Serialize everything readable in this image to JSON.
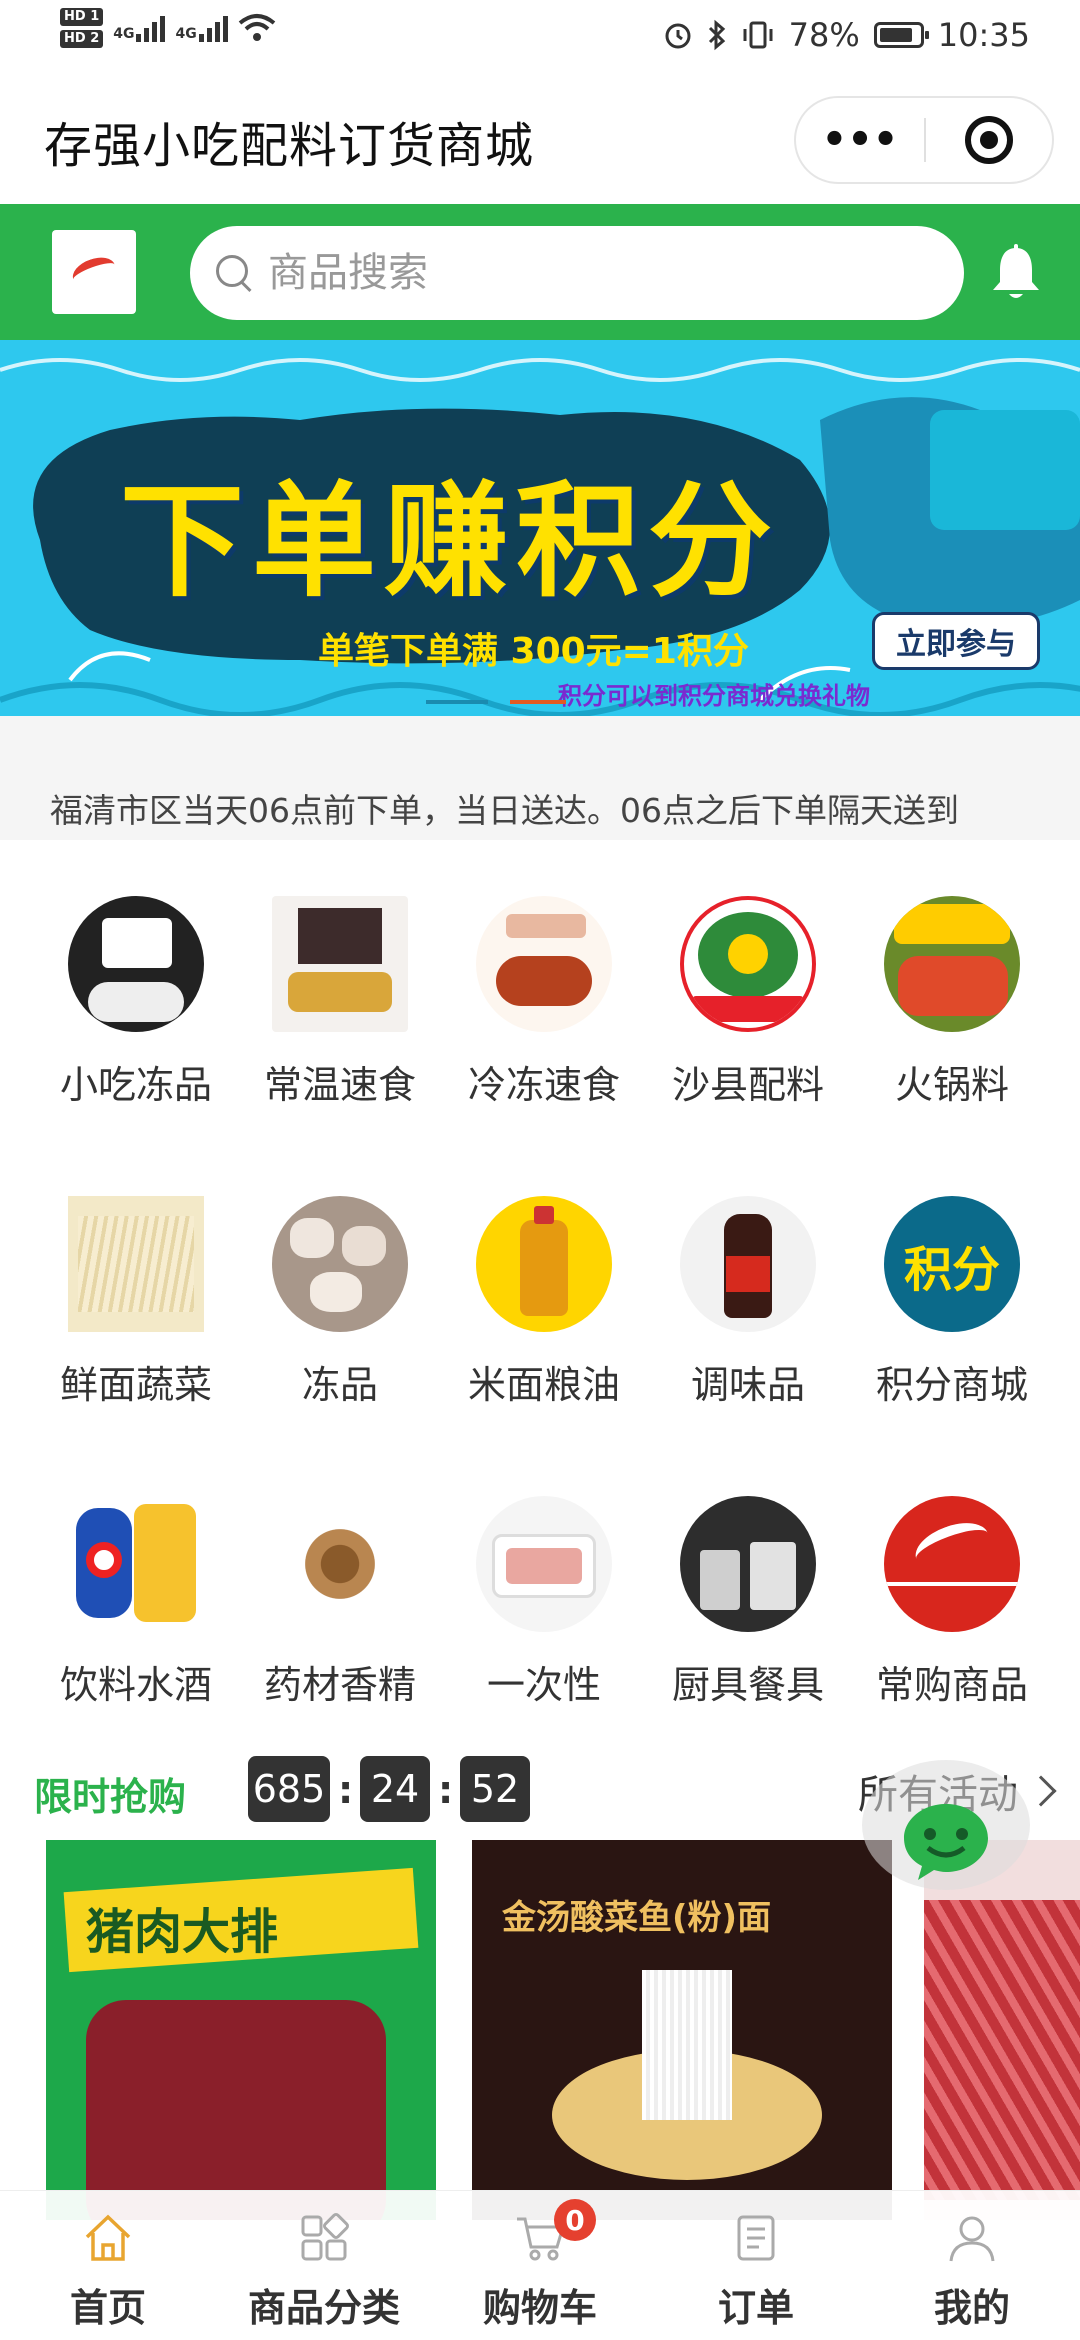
{
  "status_bar": {
    "hd1": "HD 1",
    "hd2": "HD 2",
    "net1": "4G",
    "net2": "4G",
    "battery": "78%",
    "time": "10:35"
  },
  "title_bar": {
    "title": "存强小吃配料订货商城",
    "more_label": "•••"
  },
  "search": {
    "placeholder": "商品搜索"
  },
  "banner": {
    "title": "下单赚积分",
    "subtitle": "单笔下单满 300元=1积分",
    "note": "积分可以到积分商城兑换礼物",
    "join_label": "立即参与",
    "bg_color": "#2ec8ee"
  },
  "notice": {
    "text": "福清市区当天06点前下单，当日送达。06点之后下单隔天送到"
  },
  "categories": [
    {
      "label": "小吃冻品"
    },
    {
      "label": "常温速食"
    },
    {
      "label": "冷冻速食"
    },
    {
      "label": "沙县配料"
    },
    {
      "label": "火锅料"
    },
    {
      "label": "鲜面蔬菜"
    },
    {
      "label": "冻品"
    },
    {
      "label": "米面粮油"
    },
    {
      "label": "调味品"
    },
    {
      "label": "积分商城"
    },
    {
      "label": "饮料水酒"
    },
    {
      "label": "药材香精"
    },
    {
      "label": "一次性"
    },
    {
      "label": "厨具餐具"
    },
    {
      "label": "常购商品"
    }
  ],
  "flash_sale": {
    "title": "限时抢购",
    "hours": "685",
    "minutes": "24",
    "seconds": "52",
    "all_label": "所有活动"
  },
  "products": [
    {
      "image_text": "猪肉大排"
    },
    {
      "image_text": "金汤酸菜鱼(粉)面"
    }
  ],
  "bottom_nav": {
    "items": [
      {
        "label": "首页",
        "icon": "home-icon"
      },
      {
        "label": "商品分类",
        "icon": "grid-icon"
      },
      {
        "label": "购物车",
        "icon": "cart-icon"
      },
      {
        "label": "订单",
        "icon": "order-icon"
      },
      {
        "label": "我的",
        "icon": "user-icon"
      }
    ],
    "cart_count": "0"
  },
  "colors": {
    "primary": "#2bb24c",
    "badge": "#e5402f",
    "countdown": "#333333"
  }
}
